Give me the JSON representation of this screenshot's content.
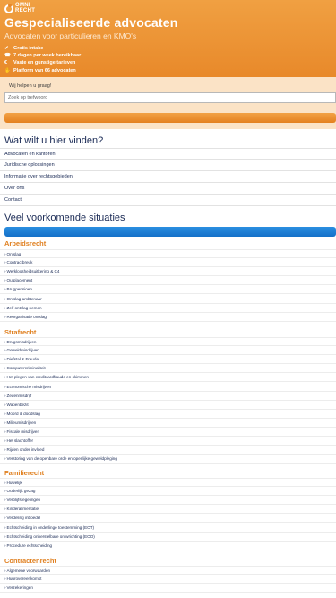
{
  "header": {
    "logo_top": "OMNI",
    "logo_bottom": "RECHT",
    "title": "Gespecialiseerde advocaten",
    "subtitle": "Advocaten voor particulieren en KMO's",
    "usps": [
      {
        "icon": "check-icon",
        "label": "Gratis intake"
      },
      {
        "icon": "phone-icon",
        "label": "7 dagen per week bereikbaar"
      },
      {
        "icon": "euro-icon",
        "label": "Vaste en gunstige tarieven"
      },
      {
        "icon": "handshake-icon",
        "label": "Platform van 66 advocaten"
      }
    ]
  },
  "search": {
    "label": "Wij helpen u graag!",
    "placeholder": "Zoek op trefwoord",
    "value": ""
  },
  "find_section": {
    "title": "Wat wilt u hier vinden?",
    "items": [
      "Advocaten en kantoren",
      "Juridische oplossingen",
      "Informatie over rechtsgebieden",
      "Over ons",
      "Contact"
    ]
  },
  "situations": {
    "title": "Veel voorkomende situaties",
    "categories": [
      {
        "title": "Arbeidsrecht",
        "items": [
          "Ontslag",
          "Contractbreuk",
          "Werkloosheidsuitkering & C4",
          "Outplacement",
          "Brugpensioen",
          "Ontslag ambtenaar",
          "Zelf ontslag nemen",
          "Reorganisatie ontslag"
        ]
      },
      {
        "title": "Strafrecht",
        "items": [
          "Drugsmisdrijven",
          "Geweldmisdrijven",
          "Diefstal & Fraude",
          "Computercriminaliteit",
          "Het plegen van creditcardfraude en skimmen",
          "Economische misdrijven",
          "Zedenmisdrijf",
          "Wapenbezit",
          "Moord & doodslag",
          "Milieumisdrijven",
          "Fiscale misdrijven",
          "Het slachtoffer",
          "Rijden onder invloed",
          "Verstoring van de openbare orde en openlijke geweldpleging"
        ]
      },
      {
        "title": "Familierecht",
        "items": [
          "Huwelijk",
          "Ouderlijk gezag",
          "Verblijfsregelingen",
          "Kinderalimentatie",
          "Verdeling inboedel",
          "Echtscheiding in onderlinge toestemming (EOT)",
          "Echtscheiding onherstelbare ontwrichting (EOO)",
          "Procedure echtscheiding"
        ]
      },
      {
        "title": "Contractenrecht",
        "items": [
          "Algemene voorwaarden",
          "Huurovereenkomst",
          "Verzekeringen"
        ]
      }
    ]
  }
}
